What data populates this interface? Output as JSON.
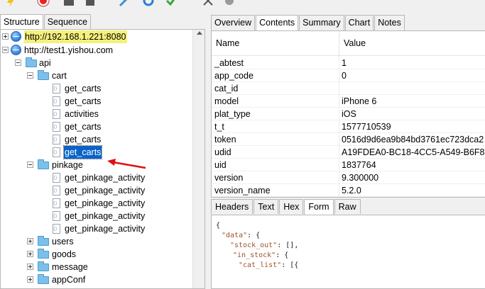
{
  "left_tabs": [
    "Structure",
    "Sequence"
  ],
  "tree": {
    "hosts": [
      {
        "label": "http://192.168.1.221:8080",
        "highlighted": true,
        "expanded": false
      },
      {
        "label": "http://test1.yishou.com",
        "highlighted": false,
        "expanded": true
      }
    ],
    "api_label": "api",
    "cart_label": "cart",
    "cart_items": [
      "get_carts",
      "get_carts",
      "activities",
      "get_carts",
      "get_carts",
      "get_carts"
    ],
    "pinkage_label": "pinkage",
    "pinkage_items": [
      "get_pinkage_activity",
      "get_pinkage_activity",
      "get_pinkage_activity",
      "get_pinkage_activity",
      "get_pinkage_activity"
    ],
    "other_folders": [
      "users",
      "goods",
      "message",
      "appConf"
    ]
  },
  "right_tabs": [
    "Overview",
    "Contents",
    "Summary",
    "Chart",
    "Notes"
  ],
  "right_active_tab": "Contents",
  "table": {
    "col_name": "Name",
    "col_value": "Value",
    "rows": [
      {
        "name": "_abtest",
        "value": "1"
      },
      {
        "name": "app_code",
        "value": "0"
      },
      {
        "name": "cat_id",
        "value": ""
      },
      {
        "name": "model",
        "value": "iPhone 6"
      },
      {
        "name": "plat_type",
        "value": "iOS"
      },
      {
        "name": "t_t",
        "value": "1577710539"
      },
      {
        "name": "token",
        "value": "0516d9d6ea9b84bd3761ec723dca2"
      },
      {
        "name": "udid",
        "value": "A19FDEA0-BC18-4CC5-A549-B6F8B"
      },
      {
        "name": "uid",
        "value": "1837764"
      },
      {
        "name": "version",
        "value": "9.300000"
      },
      {
        "name": "version_name",
        "value": "5.2.0"
      }
    ]
  },
  "sub_tabs": [
    "Headers",
    "Text",
    "Hex",
    "Form",
    "Raw"
  ],
  "sub_active_tab": "Form",
  "json_lines": [
    {
      "key": "",
      "text": "{"
    },
    {
      "key": "\"data\"",
      "text": ": {"
    },
    {
      "key": "\"stock_out\"",
      "text": ": [],"
    },
    {
      "key": "\"in_stock\"",
      "text": ": {"
    },
    {
      "key": "\"cat_list\"",
      "text": ": [{"
    }
  ],
  "colors": {
    "selection": "#0a64c8",
    "highlight": "#f5f07c",
    "arrow": "#e01010",
    "json_key": "#a0522d"
  }
}
